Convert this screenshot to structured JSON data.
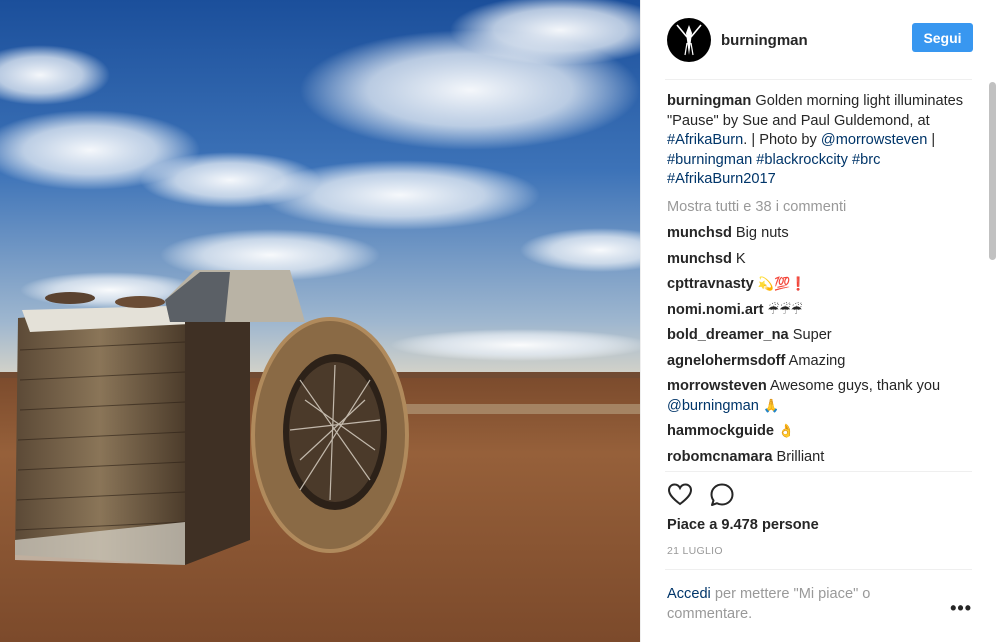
{
  "colors": {
    "accent": "#3897f0",
    "link": "#003569",
    "muted": "#999999"
  },
  "post": {
    "username": "burningman",
    "follow_label": "Segui",
    "caption": {
      "username": "burningman",
      "text_1": " Golden morning light illuminates \"Pause\" by Sue and Paul Guldemond, at ",
      "tag_1": "#AfrikaBurn",
      "text_2": ". | Photo by ",
      "tag_2": "@morrowsteven",
      "text_3": " | ",
      "tag_3": "#burningman",
      "text_4": " ",
      "tag_4": "#blackrockcity",
      "text_5": " ",
      "tag_5": "#brc",
      "text_6": " ",
      "tag_6": "#AfrikaBurn2017"
    },
    "show_all_comments": "Mostra tutti e 38 i commenti",
    "comments": [
      {
        "user": "munchsd",
        "text": " Big nuts"
      },
      {
        "user": "munchsd",
        "text": " K"
      },
      {
        "user": "cpttravnasty",
        "text": " 💫💯❗"
      },
      {
        "user": "nomi.nomi.art",
        "text": " ☔☔☔"
      },
      {
        "user": "bold_dreamer_na",
        "text": " Super"
      },
      {
        "user": "agnelohermsdoff",
        "text": " Amazing"
      },
      {
        "user": "morrowsteven",
        "text": " Awesome guys, thank you ",
        "mention": "@burningman",
        "suffix": " 🙏"
      },
      {
        "user": "hammockguide",
        "text": " 👌"
      },
      {
        "user": "robomcnamara",
        "text": " Brilliant"
      }
    ],
    "likes": "Piace a 9.478 persone",
    "date": "21 LUGLIO",
    "login_link": "Accedi",
    "login_text": " per mettere \"Mi piace\" o commentare.",
    "more_label": "•••",
    "icons": {
      "like": "heart-icon",
      "comment": "comment-icon",
      "more": "more-options-icon",
      "avatar": "burningman-logo-icon"
    }
  }
}
